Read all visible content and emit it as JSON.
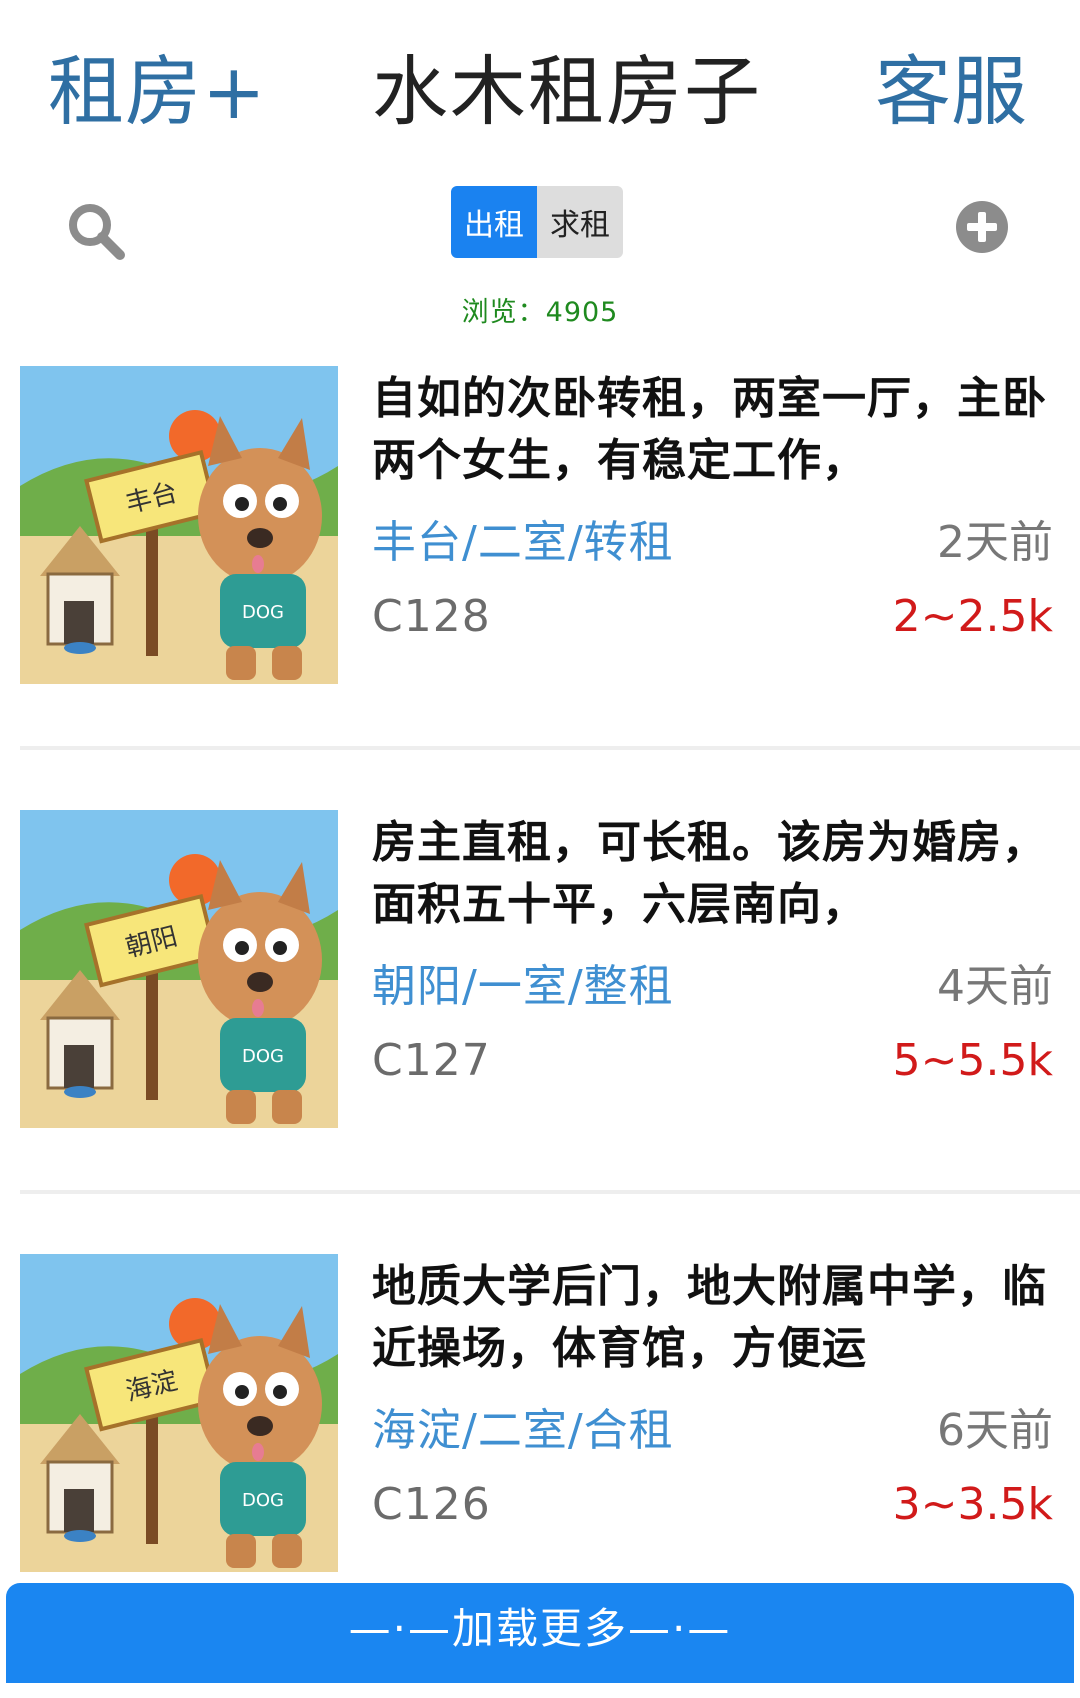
{
  "header": {
    "left": "租房+",
    "title": "水木租房子",
    "right": "客服"
  },
  "toolbar": {
    "search_icon": "search-icon",
    "tabs": [
      {
        "label": "出租",
        "active": true
      },
      {
        "label": "求租",
        "active": false
      }
    ],
    "add_icon": "plus-circle-icon"
  },
  "views": "浏览：4905",
  "listings": [
    {
      "area": "丰台",
      "title": "自如的次卧转租，两室一厅，主卧两个女生，有稳定工作，",
      "tags": "丰台/二室/转租",
      "time": "2天前",
      "code": "C128",
      "price": "2~2.5k"
    },
    {
      "area": "朝阳",
      "title": "房主直租，可长租。该房为婚房，面积五十平，六层南向，",
      "tags": "朝阳/一室/整租",
      "time": "4天前",
      "code": "C127",
      "price": "5~5.5k"
    },
    {
      "area": "海淀",
      "title": "地质大学后门，地大附属中学，临近操场，体育馆，方便运",
      "tags": "海淀/二室/合租",
      "time": "6天前",
      "code": "C126",
      "price": "3~3.5k"
    }
  ],
  "load_more": "—·—加载更多—·—",
  "colors": {
    "accent": "#1a82f0",
    "price": "#d11a1a",
    "tag": "#3f8fd1",
    "views": "#1f8a1f"
  }
}
